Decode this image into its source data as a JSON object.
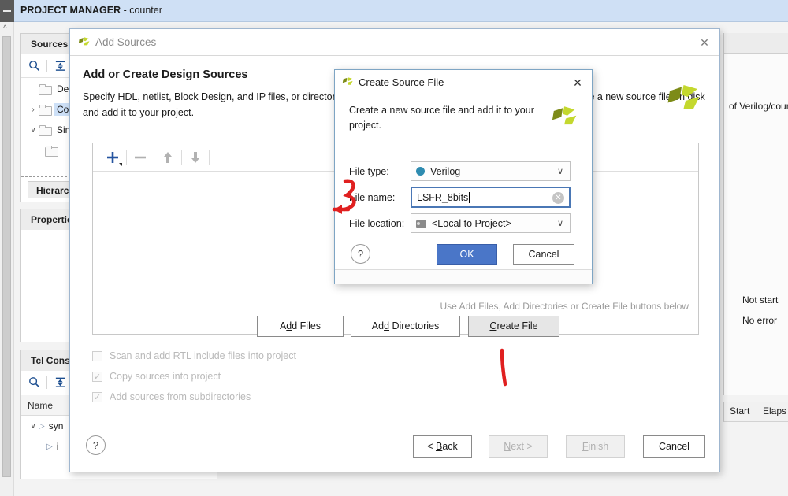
{
  "ide": {
    "title_bold": "PROJECT MANAGER",
    "title_rest": " - counter",
    "sources_panel": {
      "tab_label": "Sources",
      "search_icon": "search-icon",
      "collapse_icon": "collapse-all-icon",
      "tree_items": [
        {
          "label": "De",
          "twisty": "",
          "selected": false
        },
        {
          "label": "Co",
          "twisty": "›",
          "selected": true
        },
        {
          "label": "Sim",
          "twisty": "∨",
          "selected": false
        },
        {
          "label": "",
          "twisty": "",
          "selected": false
        }
      ],
      "hierarchy_tab": "Hierarch"
    },
    "properties_panel": {
      "tab_label": "Propertie"
    },
    "tcl_panel": {
      "tab_label": "Tcl Consc",
      "column_header": "Name",
      "rows": [
        {
          "label": "syn",
          "indent": 0
        },
        {
          "label": "i",
          "indent": 1
        }
      ]
    },
    "right_fragments": {
      "verilog_path": "of Verilog/counte",
      "not_started": "Not start",
      "no_errors": "No error",
      "col_start": "Start",
      "col_elapsed": "Elaps"
    }
  },
  "add_sources_dialog": {
    "title": "Add Sources",
    "close_icon": "close-icon",
    "heading": "Add or Create Design Sources",
    "description": "Specify HDL, netlist, Block Design, and IP files, or directories containing those file types to add to your project. Create a new source file on disk and add it to your project.",
    "toolbar": {
      "add_icon": "plus-icon",
      "remove_icon": "minus-icon",
      "move_up_icon": "arrow-up-icon",
      "move_down_icon": "arrow-down-icon"
    },
    "empty_hint": "Use Add Files, Add Directories or Create File buttons below",
    "file_buttons": [
      {
        "id": "add-files",
        "pre": "A",
        "accel": "d",
        "post": "d Files",
        "style": "normal"
      },
      {
        "id": "add-directories",
        "pre": "Ad",
        "accel": "d",
        "post": " Directories",
        "style": "normal"
      },
      {
        "id": "create-file",
        "pre": "",
        "accel": "C",
        "post": "reate File",
        "style": "gray"
      }
    ],
    "checkboxes": [
      {
        "label": "Scan and add RTL include files into project",
        "checked": false
      },
      {
        "label": "Copy sources into project",
        "checked": true
      },
      {
        "label": "Add sources from subdirectories",
        "checked": true
      }
    ],
    "help_icon": "question-mark-icon",
    "wizard_buttons": [
      {
        "id": "back",
        "label": "< Back",
        "state": "enabled"
      },
      {
        "id": "next",
        "label": "Next >",
        "state": "disabled"
      },
      {
        "id": "finish",
        "label": "Finish",
        "state": "disabled"
      },
      {
        "id": "cancel",
        "label": "Cancel",
        "state": "enabled"
      }
    ]
  },
  "create_source_dialog": {
    "title": "Create Source File",
    "close_icon": "close-icon",
    "description": "Create a new source file and add it to your project.",
    "fields": {
      "file_type": {
        "label_pre": "F",
        "label_accel": "i",
        "label_post": "le type:",
        "value": "Verilog",
        "dot_color": "#2e8bb0"
      },
      "file_name": {
        "label_pre": "F",
        "label_accel": "i",
        "label_post": "le name:",
        "value": "LSFR_8bits",
        "clear_icon": "clear-input-icon"
      },
      "file_location": {
        "label_pre": "Fil",
        "label_accel": "e",
        "label_post": " location:",
        "value": "<Local to Project>",
        "folder_icon": "location-folder-icon"
      }
    },
    "help_icon": "question-mark-icon",
    "ok_label": "OK",
    "cancel_label": "Cancel"
  },
  "annotations": [
    {
      "name": "red-arrow-filename",
      "kind": "arrow"
    },
    {
      "name": "red-stroke-createfile",
      "kind": "stroke"
    }
  ],
  "colors": {
    "title_bar": "#cfe0f5",
    "accent_blue": "#4a76c8",
    "selection": "#cde0f7",
    "annotation_red": "#e02020",
    "logo_dark": "#7d8b18",
    "logo_light": "#c4d82e"
  }
}
